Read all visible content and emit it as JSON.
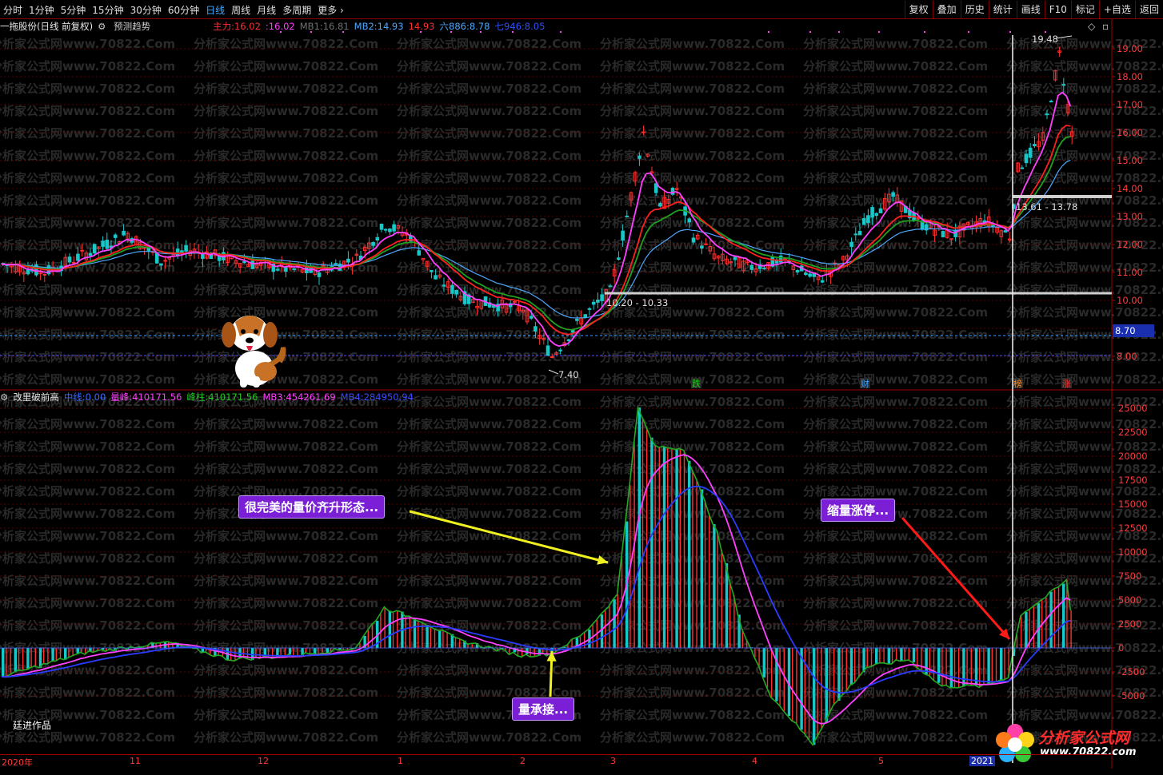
{
  "toolbar": {
    "periods": [
      "分时",
      "1分钟",
      "5分钟",
      "15分钟",
      "30分钟",
      "60分钟",
      "日线",
      "周线",
      "月线",
      "多周期",
      "更多"
    ],
    "active_period": "日线",
    "tools": [
      "复权",
      "叠加",
      "历史",
      "统计",
      "画线",
      "F10",
      "标记",
      "+自选",
      "返回"
    ]
  },
  "price_panel": {
    "title": "一拖股份(日线 前复权)",
    "predict_label": "预测趋势",
    "indicators": [
      {
        "label": "主力:",
        "value": "16.02",
        "color": "#ff3030"
      },
      {
        "label": ":16.02",
        "value": "",
        "color": "#ff40ff"
      },
      {
        "label": "MB1:",
        "value": "16.81",
        "color": "#707070"
      },
      {
        "label": "MB2:",
        "value": "14.93",
        "color": "#4aa8ff"
      },
      {
        "label": "",
        "value": "14.93",
        "color": "#ff3030"
      },
      {
        "label": "六886:",
        "value": "8.78",
        "color": "#4aa8ff"
      },
      {
        "label": "七946:",
        "value": "8.05",
        "color": "#3050ff"
      }
    ],
    "annotations": {
      "high": "19.48",
      "low": "7.40",
      "zone1": "10.20 - 10.33",
      "zone2": "13.61 - 13.78",
      "current_price_tag": "8.70"
    },
    "event_markers": [
      {
        "text": "跌",
        "color": "#22cc22"
      },
      {
        "text": "财",
        "color": "#3aa0ff"
      },
      {
        "text": "榜",
        "color": "#ff8c1a"
      },
      {
        "text": "涨",
        "color": "#ff3030"
      }
    ],
    "y_ticks": [
      "19.00",
      "18.00",
      "17.00",
      "16.00",
      "15.00",
      "14.00",
      "13.00",
      "12.00",
      "11.00",
      "10.00",
      "9.00",
      "8.00"
    ]
  },
  "volume_panel": {
    "title": "改里破前高",
    "indicators": [
      {
        "label": "中线:",
        "value": "0.00",
        "color": "#3a6bff"
      },
      {
        "label": "量峰:",
        "value": "410171.56",
        "color": "#ff40ff"
      },
      {
        "label": "峰柱:",
        "value": "410171.56",
        "color": "#22cc22"
      },
      {
        "label": "MB3:",
        "value": "454261.69",
        "color": "#ff40ff"
      },
      {
        "label": "MB4:",
        "value": "284950.94",
        "color": "#3a4bff"
      }
    ],
    "y_ticks": [
      "25000",
      "22500",
      "20000",
      "17500",
      "15000",
      "12500",
      "10000",
      "7500",
      "5000",
      "2500",
      "0",
      "-2500",
      "-5000"
    ]
  },
  "callouts": {
    "perfect": "很完美的量价齐升形态...",
    "accept": "量承接...",
    "shrink": "缩量涨停..."
  },
  "time_axis": [
    "2020年",
    "11",
    "12",
    "1",
    "2",
    "3",
    "4",
    "5",
    "2021"
  ],
  "watermark": "分析家公式网www.70822.Com",
  "author": "廷进作品",
  "brand": {
    "name": "分析家公式网",
    "url": "www.70822.com"
  },
  "colors": {
    "bull": "#ff3030",
    "bear": "#18c8c8",
    "ma_magenta": "#ff40ff",
    "ma_red": "#ff2020",
    "ma_green": "#20a020",
    "ma_blue": "#4aa8ff",
    "axis": "#a00000"
  }
}
